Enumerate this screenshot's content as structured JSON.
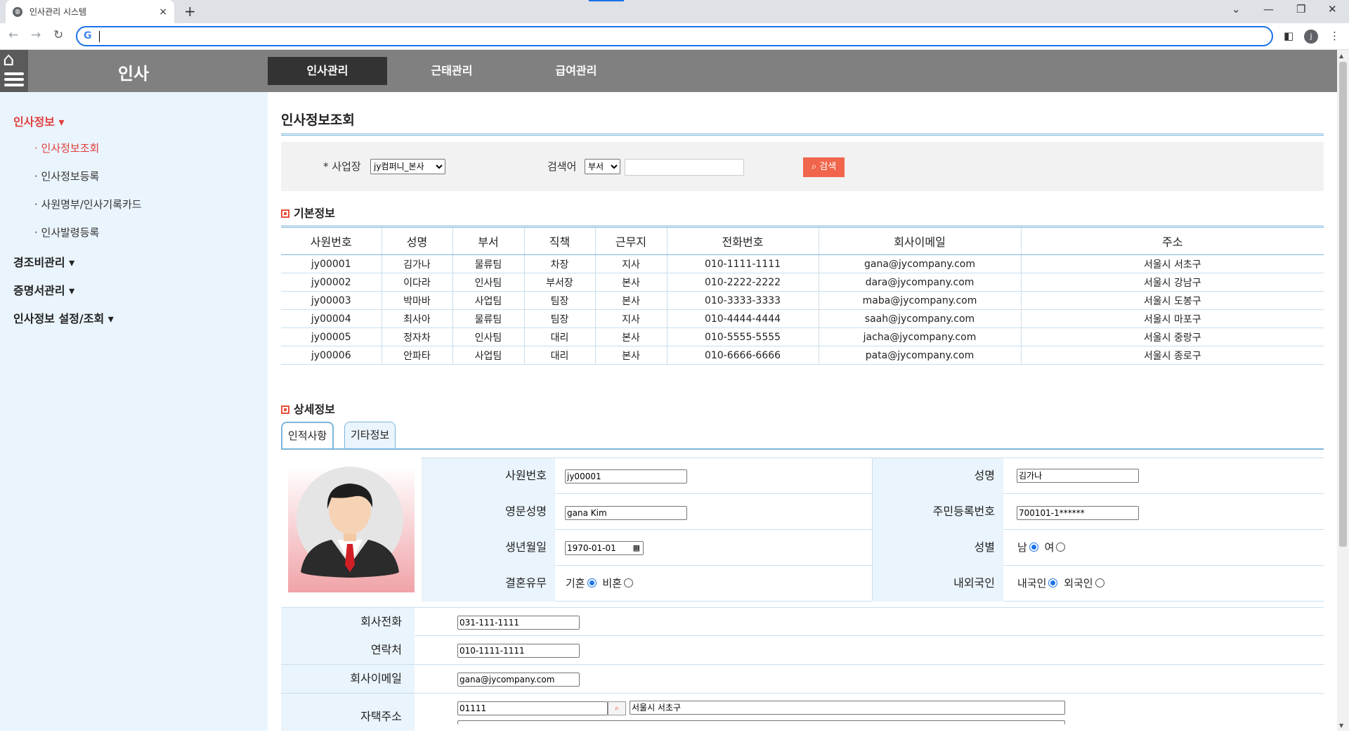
{
  "browser": {
    "tab_title": "인사관리 시스템",
    "tab_close": "×",
    "new_tab": "+",
    "address_value": ""
  },
  "header": {
    "app_title": "인사",
    "tabs": [
      {
        "label": "인사관리",
        "active": true
      },
      {
        "label": "근태관리",
        "active": false
      },
      {
        "label": "급여관리",
        "active": false
      }
    ]
  },
  "sidebar": {
    "groups": [
      {
        "label": "인사정보 ▾",
        "active": true
      },
      {
        "label": "경조비관리 ▾"
      },
      {
        "label": "증명서관리 ▾"
      },
      {
        "label": "인사정보 설정/조회 ▾"
      }
    ],
    "subitems": [
      {
        "label": "· 인사정보조회",
        "active": true
      },
      {
        "label": "· 인사정보등록"
      },
      {
        "label": "· 사원명부/인사기록카드"
      },
      {
        "label": "· 인사발령등록"
      }
    ]
  },
  "page": {
    "title": "인사정보조회"
  },
  "search": {
    "site_label": "* 사업장",
    "site_value": "jy컴퍼니_본사",
    "keyword_label": "검색어",
    "keyword_type": "부서",
    "keyword_value": "",
    "button_label": "검색"
  },
  "basic": {
    "section_title": "기본정보",
    "columns": [
      "사원번호",
      "성명",
      "부서",
      "직책",
      "근무지",
      "전화번호",
      "회사이메일",
      "주소"
    ],
    "rows": [
      [
        "jy00001",
        "김가나",
        "물류팀",
        "차장",
        "지사",
        "010-1111-1111",
        "gana@jycompany.com",
        "서울시 서초구"
      ],
      [
        "jy00002",
        "이다라",
        "인사팀",
        "부서장",
        "본사",
        "010-2222-2222",
        "dara@jycompany.com",
        "서울시 강남구"
      ],
      [
        "jy00003",
        "박마바",
        "사업팀",
        "팀장",
        "본사",
        "010-3333-3333",
        "maba@jycompany.com",
        "서울시 도봉구"
      ],
      [
        "jy00004",
        "최사아",
        "물류팀",
        "팀장",
        "지사",
        "010-4444-4444",
        "saah@jycompany.com",
        "서울시 마포구"
      ],
      [
        "jy00005",
        "정자차",
        "인사팀",
        "대리",
        "본사",
        "010-5555-5555",
        "jacha@jycompany.com",
        "서울시 중랑구"
      ],
      [
        "jy00006",
        "안파타",
        "사업팀",
        "대리",
        "본사",
        "010-6666-6666",
        "pata@jycompany.com",
        "서울시 종로구"
      ]
    ]
  },
  "detail": {
    "section_title": "상세정보",
    "tabs": [
      {
        "label": "인적사항",
        "active": true
      },
      {
        "label": "기타정보",
        "active": false
      }
    ],
    "fields": {
      "emp_no_label": "사원번호",
      "emp_no": "jy00001",
      "name_label": "성명",
      "name": "김가나",
      "eng_name_label": "영문성명",
      "eng_name": "gana Kim",
      "rrn_label": "주민등록번호",
      "rrn": "700101-1******",
      "birth_label": "생년월일",
      "birth": "1970-01-01",
      "gender_label": "성별",
      "gender_m": "남",
      "gender_f": "여",
      "marital_label": "결혼유무",
      "married": "기혼",
      "single": "비혼",
      "nation_label": "내외국인",
      "domestic": "내국인",
      "foreign": "외국인",
      "company_phone_label": "회사전화",
      "company_phone": "031-111-1111",
      "contact_label": "연락처",
      "contact": "010-1111-1111",
      "company_email_label": "회사이메일",
      "company_email": "gana@jycompany.com",
      "home_addr_label": "자택주소",
      "zip": "01111",
      "address": "서울시 서초구"
    }
  },
  "colors": {
    "header_bg": "#808080",
    "active_tab_bg": "#333333",
    "sidebar_bg": "#eaf4fc",
    "accent_red": "#e13d3d",
    "search_button": "#f0654c",
    "rule_blue": "#7bb6da"
  }
}
